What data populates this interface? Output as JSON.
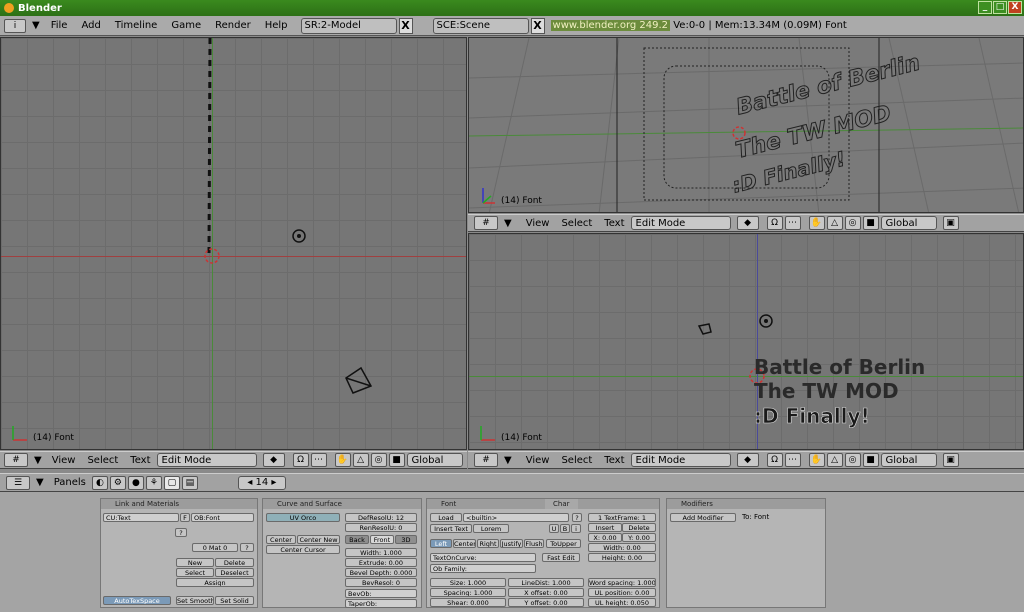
{
  "window": {
    "title": "Blender",
    "btn_min": "_",
    "btn_max": "□",
    "btn_close": "X"
  },
  "topbar": {
    "menus": [
      "File",
      "Add",
      "Timeline",
      "Game",
      "Render",
      "Help"
    ],
    "screen": "SR:2-Model",
    "scene": "SCE:Scene",
    "x": "X",
    "url": "www.blender.org 249.2",
    "stats": "Ve:0-0 | Mem:13.34M (0.09M) Font"
  },
  "viewports": {
    "label": "(14) Font"
  },
  "header": {
    "view": "View",
    "select": "Select",
    "text": "Text",
    "mode": "Edit Mode",
    "orientation": "Global"
  },
  "buttons_header": {
    "panels": "Panels",
    "frame": "14"
  },
  "text3d": {
    "line1": "Battle of Berlin",
    "line2": "The TW MOD",
    "line3": ":D Finally!"
  },
  "panels": {
    "link": {
      "title": "Link and Materials",
      "cu": "CU:Text",
      "f": "F",
      "ob": "OB:Font",
      "q": "?",
      "mat": "0 Mat 0",
      "mq": "?",
      "new": "New",
      "delete": "Delete",
      "select": "Select",
      "deselect": "Deselect",
      "assign": "Assign",
      "autotex": "AutoTexSpace",
      "smooth": "Set Smooth",
      "solid": "Set Solid"
    },
    "curve": {
      "title": "Curve and Surface",
      "uvorco": "UV Orco",
      "defresol": "DefResolU: 12",
      "renresol": "RenResolU: 0",
      "back": "Back",
      "front": "Front",
      "threed": "3D",
      "center": "Center",
      "centernew": "Center New",
      "centercursor": "Center Cursor",
      "width": "Width: 1.000",
      "extrude": "Extrude: 0.00",
      "bevel": "Bevel Depth: 0.000",
      "bevresol": "BevResol: 0",
      "bevob": "BevOb:",
      "taperob": "TaperOb:"
    },
    "font": {
      "title": "Font",
      "tab_char": "Char",
      "load": "Load",
      "builtin": "<builtin>",
      "q": "?",
      "insert": "Insert Text",
      "lorem": "Lorem",
      "u": "U",
      "b": "B",
      "i": "i",
      "left": "Left",
      "center": "Center",
      "right": "Right",
      "justify": "Justify",
      "flush": "Flush",
      "toupper": "ToUpper",
      "textoncurve": "TextOnCurve:",
      "fastedit": "Fast Edit",
      "obfamily": "Ob Family:",
      "size": "Size: 1.000",
      "linedist": "LineDist: 1.000",
      "spacing": "Spacing: 1.000",
      "xoffset": "X offset: 0.00",
      "shear": "Shear: 0.000",
      "yoffset": "Y offset: 0.00",
      "textframe": "1 TextFrame: 1",
      "tinsert": "Insert",
      "tdelete": "Delete",
      "fx": "X: 0.00",
      "fy": "Y: 0.00",
      "fwidth": "Width: 0.00",
      "fheight": "Height: 0.00",
      "wordspacing": "Word spacing: 1.000",
      "ulpos": "UL position: 0.00",
      "ulheight": "UL height: 0.050"
    },
    "modifiers": {
      "title": "Modifiers",
      "add": "Add Modifier",
      "to": "To: Font"
    }
  }
}
